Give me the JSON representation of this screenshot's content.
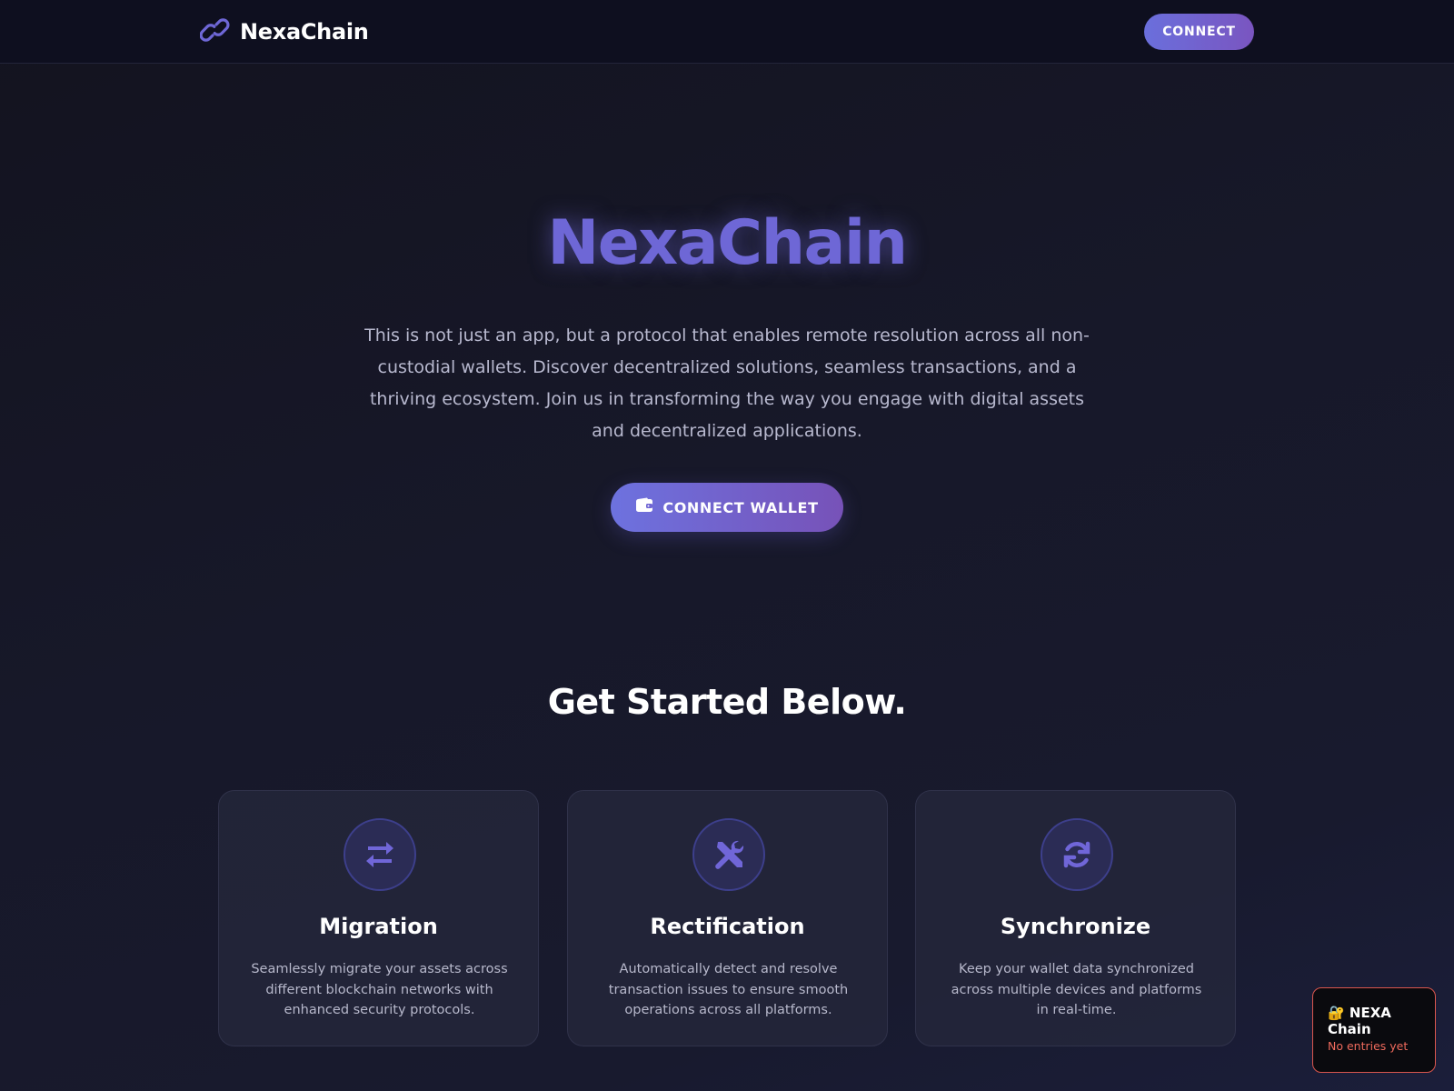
{
  "colors": {
    "accent": "#6e67d6",
    "button_gradient_start": "#6a6fdc",
    "button_gradient_end": "#7a55c0",
    "background": "#171829",
    "widget_border": "#d9564e",
    "widget_status": "#ef6a5c"
  },
  "nav": {
    "logo_icon": "link-chain-icon",
    "brand": "NexaChain",
    "connect_label": "CONNECT"
  },
  "hero": {
    "title": "NexaChain",
    "description": "This is not just an app, but a protocol that enables remote resolution across all non-custodial wallets. Discover decentralized solutions, seamless transactions, and a thriving ecosystem. Join us in transforming the way you engage with digital assets and decentralized applications.",
    "cta_icon": "wallet-icon",
    "cta_label": "CONNECT WALLET"
  },
  "features": {
    "heading": "Get Started Below.",
    "cards": [
      {
        "icon": "exchange-arrows-icon",
        "title": "Migration",
        "description": "Seamlessly migrate your assets across different blockchain networks with enhanced security protocols."
      },
      {
        "icon": "tools-icon",
        "title": "Rectification",
        "description": "Automatically detect and resolve transaction issues to ensure smooth operations across all platforms."
      },
      {
        "icon": "sync-icon",
        "title": "Synchronize",
        "description": "Keep your wallet data synchronized across multiple devices and platforms in real-time."
      }
    ]
  },
  "widget": {
    "title": "🔐 NEXA Chain",
    "status": "No entries yet"
  }
}
